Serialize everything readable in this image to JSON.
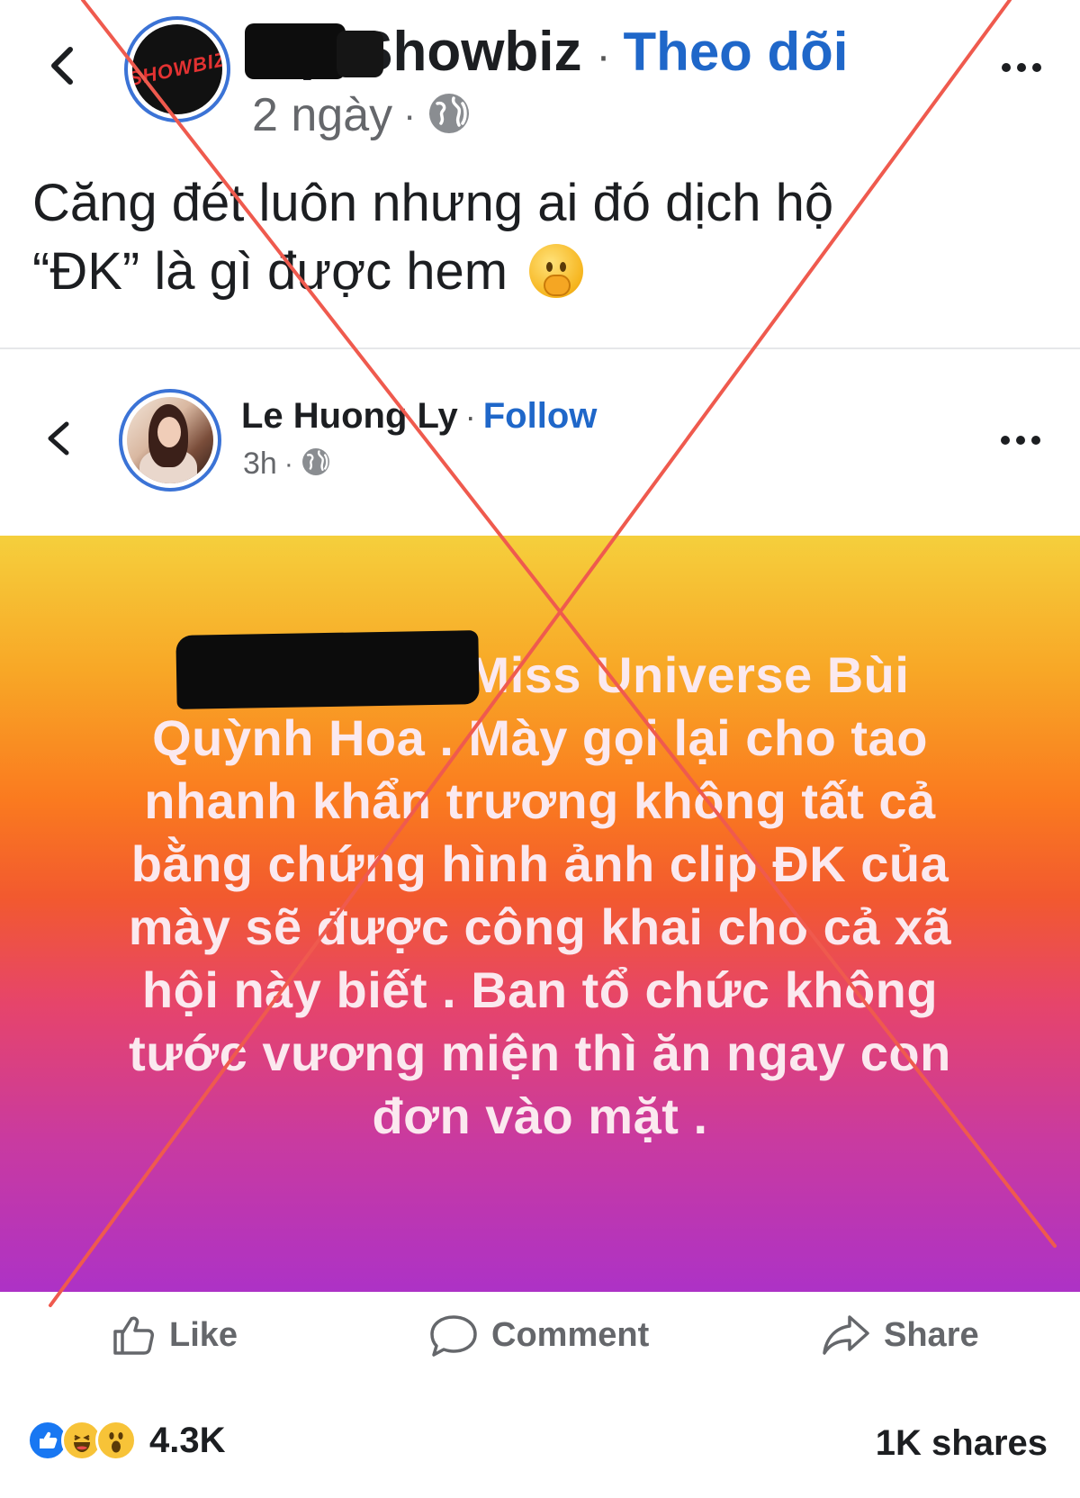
{
  "outer_post": {
    "page_name": "Bụi Showbiz",
    "avatar_logo_text": "SHOWBIZ",
    "follow_label": "Theo dõi",
    "separator": "·",
    "time": "2 ngày",
    "meta_separator": "·",
    "caption_line1": "Căng đét luôn nhưng ai đó dịch hộ",
    "caption_line2": "“ĐK” là gì được hem",
    "caption_emoji": "face-with-hand-over-mouth"
  },
  "shared_post": {
    "author": "Le Huong Ly",
    "separator": "·",
    "follow_label": "Follow",
    "time": "3h",
    "meta_separator": "·",
    "story_lines": [
      "Miss Universe Bùi",
      "Quỳnh Hoa . Mày gọi lại cho tao",
      "nhanh khẩn trương không tất cả",
      "bằng chứng hình ảnh clip ĐK của",
      "mày sẽ được công khai cho cả xã",
      "hội này biết . Ban tổ chức không",
      "tước vương miện thì ăn ngay con",
      "đơn vào mặt ."
    ],
    "story_gradient": [
      "#f5cf3c",
      "#fa7a1f",
      "#e6446b",
      "#ad32c6"
    ]
  },
  "actions": {
    "like_label": "Like",
    "comment_label": "Comment",
    "share_label": "Share"
  },
  "stats": {
    "reaction_icons": [
      "like-icon",
      "haha-icon",
      "wow-icon"
    ],
    "reaction_count": "4.3K",
    "shares": "1K shares"
  },
  "colors": {
    "link_blue": "#1f67c9",
    "overlay_x": "#ef5a4e",
    "avatar_ring": "#3b73d6"
  }
}
